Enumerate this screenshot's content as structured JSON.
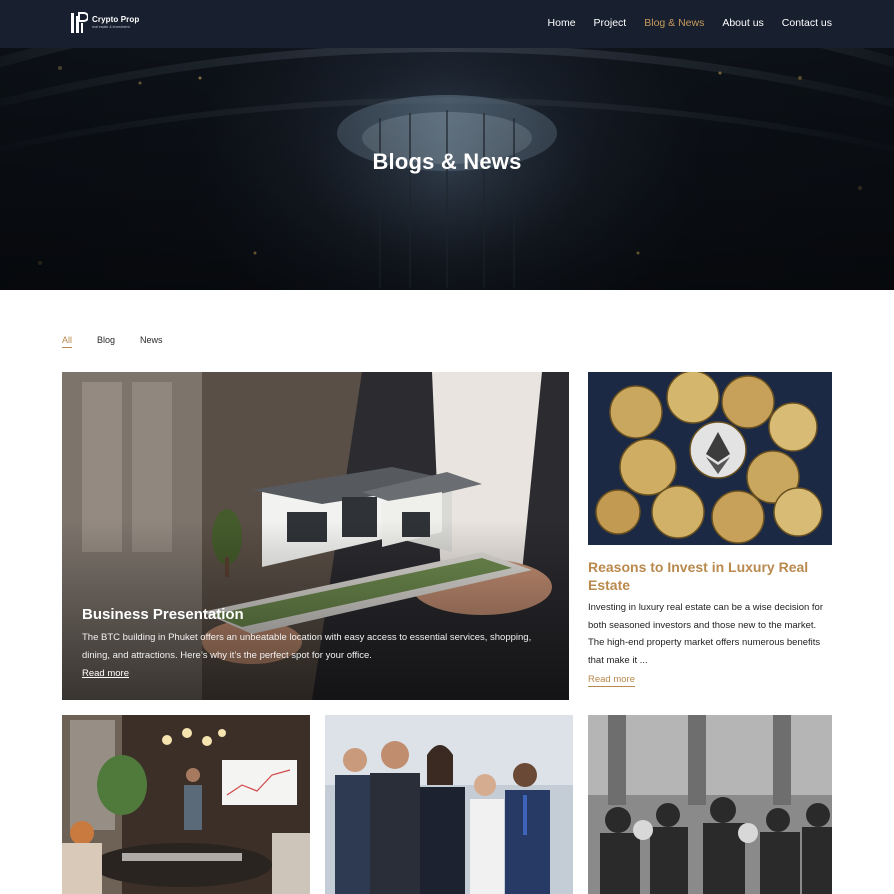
{
  "nav": {
    "logo": {
      "name": "Crypto Prop",
      "tagline": "real estate & investment"
    },
    "items": [
      {
        "label": "Home",
        "active": false
      },
      {
        "label": "Project",
        "active": false
      },
      {
        "label": "Blog & News",
        "active": true
      },
      {
        "label": "About us",
        "active": false
      },
      {
        "label": "Contact us",
        "active": false
      }
    ]
  },
  "hero": {
    "title": "Blogs & News"
  },
  "filters": [
    {
      "label": "All",
      "active": true
    },
    {
      "label": "Blog",
      "active": false
    },
    {
      "label": "News",
      "active": false
    }
  ],
  "featured": {
    "title": "Business Presentation",
    "description": "The BTC building in Phuket offers an unbeatable location with easy access to essential services, shopping, dining, and attractions. Here’s why it’s the perfect spot for your office.",
    "link": "Read more"
  },
  "side_post": {
    "title": "Reasons to Invest in Luxury Real Estate",
    "description": "Investing in luxury real estate can be a wise decision for both seasoned investors and those new to the market. The high-end property market offers numerous benefits that make it ...",
    "link": "Read more"
  },
  "colors": {
    "nav_bg": "#18202f",
    "accent": "#c7995c",
    "accent_dark": "#b9894d"
  }
}
